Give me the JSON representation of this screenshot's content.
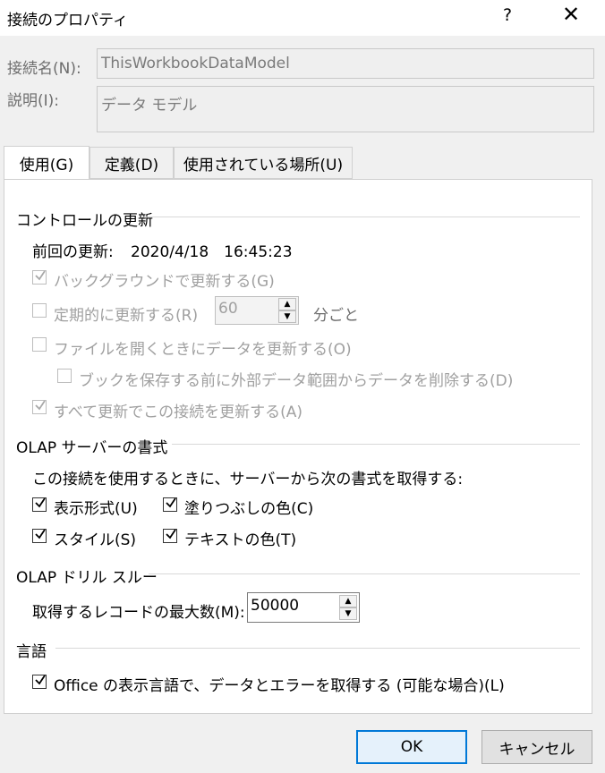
{
  "window": {
    "title": "接続のプロパティ",
    "help": "?",
    "close": "✕"
  },
  "name": {
    "label": "接続名(N):",
    "value": "ThisWorkbookDataModel"
  },
  "description": {
    "label": "説明(I):",
    "value": "データ モデル"
  },
  "tabs": [
    {
      "label": "使用(G)"
    },
    {
      "label": "定義(D)"
    },
    {
      "label": "使用されている場所(U)"
    }
  ],
  "refresh": {
    "section": "コントロールの更新",
    "last_refresh_label": "前回の更新:",
    "last_refresh_value": "2020/4/18　16:45:23",
    "background": "バックグラウンドで更新する(G)",
    "periodic": "定期的に更新する(R)",
    "periodic_value": "60",
    "periodic_unit": "分ごと",
    "on_open": "ファイルを開くときにデータを更新する(O)",
    "remove_external": "ブックを保存する前に外部データ範囲からデータを削除する(D)",
    "refresh_all": "すべて更新でこの接続を更新する(A)"
  },
  "olap_format": {
    "section": "OLAP サーバーの書式",
    "intro": "この接続を使用するときに、サーバーから次の書式を取得する:",
    "number_format": "表示形式(U)",
    "fill_color": "塗りつぶしの色(C)",
    "style": "スタイル(S)",
    "text_color": "テキストの色(T)"
  },
  "drill": {
    "section": "OLAP ドリル スルー",
    "max_records_label": "取得するレコードの最大数(M):",
    "max_records_value": "50000"
  },
  "language": {
    "section": "言語",
    "office_language": "Office の表示言語で、データとエラーを取得する (可能な場合)(L)"
  },
  "buttons": {
    "ok": "OK",
    "cancel": "キャンセル"
  }
}
